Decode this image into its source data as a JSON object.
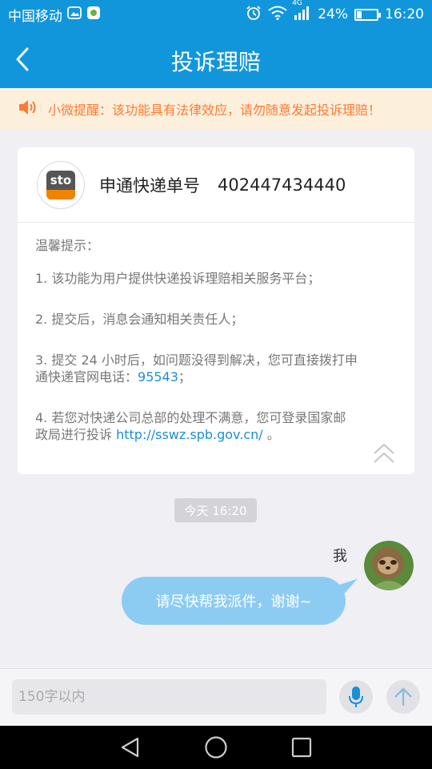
{
  "status_bar": {
    "carrier": "中国移动",
    "network": "4G",
    "battery_text": "24%",
    "battery_level": 0.24,
    "time": "16:20"
  },
  "header": {
    "title": "投诉理赔",
    "back_icon": "chevron-left-icon"
  },
  "notice": {
    "icon": "speaker-icon",
    "text": "小微提醒：该功能具有法律效应，请勿随意发起投诉理赔！"
  },
  "card": {
    "logo_text": "sto",
    "carrier_label": "申通快递单号",
    "tracking_number": "402447434440",
    "tips_title": "温馨提示：",
    "tip1": "1. 该功能为用户提供快递投诉理赔相关服务平台；",
    "tip2": "2. 提交后，消息会通知相关责任人；",
    "tip3_line1": "3. 提交 24 小时后，如问题没得到解决，您可直接拨打申",
    "tip3_line2_prefix": "通快递官网电话：",
    "tip3_phone": "95543",
    "tip3_suffix": "；",
    "tip4_line1": "4. 若您对快递公司总部的处理不满意，您可登录国家邮",
    "tip4_line2_prefix": "政局进行投诉 ",
    "tip4_link": "http://sswz.spb.gov.cn/",
    "tip4_suffix": " 。"
  },
  "chat": {
    "time_label": "今天 16:20",
    "sender_label": "我",
    "message": "请尽快帮我派件，谢谢~"
  },
  "input_bar": {
    "placeholder": "150字以内"
  },
  "colors": {
    "primary": "#1296db",
    "notice_bg": "#fcf0dd",
    "notice_text": "#ff7a33",
    "bubble": "#8dccf2",
    "link": "#1a8fd8"
  }
}
